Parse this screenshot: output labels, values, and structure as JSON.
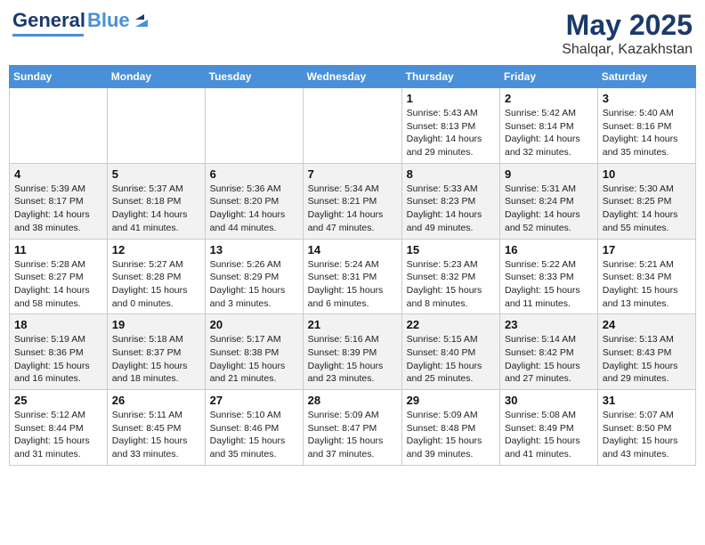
{
  "header": {
    "logo_general": "General",
    "logo_blue": "Blue",
    "month_year": "May 2025",
    "location": "Shalqar, Kazakhstan"
  },
  "days_of_week": [
    "Sunday",
    "Monday",
    "Tuesday",
    "Wednesday",
    "Thursday",
    "Friday",
    "Saturday"
  ],
  "weeks": [
    [
      {
        "day": "",
        "info": ""
      },
      {
        "day": "",
        "info": ""
      },
      {
        "day": "",
        "info": ""
      },
      {
        "day": "",
        "info": ""
      },
      {
        "day": "1",
        "info": "Sunrise: 5:43 AM\nSunset: 8:13 PM\nDaylight: 14 hours\nand 29 minutes."
      },
      {
        "day": "2",
        "info": "Sunrise: 5:42 AM\nSunset: 8:14 PM\nDaylight: 14 hours\nand 32 minutes."
      },
      {
        "day": "3",
        "info": "Sunrise: 5:40 AM\nSunset: 8:16 PM\nDaylight: 14 hours\nand 35 minutes."
      }
    ],
    [
      {
        "day": "4",
        "info": "Sunrise: 5:39 AM\nSunset: 8:17 PM\nDaylight: 14 hours\nand 38 minutes."
      },
      {
        "day": "5",
        "info": "Sunrise: 5:37 AM\nSunset: 8:18 PM\nDaylight: 14 hours\nand 41 minutes."
      },
      {
        "day": "6",
        "info": "Sunrise: 5:36 AM\nSunset: 8:20 PM\nDaylight: 14 hours\nand 44 minutes."
      },
      {
        "day": "7",
        "info": "Sunrise: 5:34 AM\nSunset: 8:21 PM\nDaylight: 14 hours\nand 47 minutes."
      },
      {
        "day": "8",
        "info": "Sunrise: 5:33 AM\nSunset: 8:23 PM\nDaylight: 14 hours\nand 49 minutes."
      },
      {
        "day": "9",
        "info": "Sunrise: 5:31 AM\nSunset: 8:24 PM\nDaylight: 14 hours\nand 52 minutes."
      },
      {
        "day": "10",
        "info": "Sunrise: 5:30 AM\nSunset: 8:25 PM\nDaylight: 14 hours\nand 55 minutes."
      }
    ],
    [
      {
        "day": "11",
        "info": "Sunrise: 5:28 AM\nSunset: 8:27 PM\nDaylight: 14 hours\nand 58 minutes."
      },
      {
        "day": "12",
        "info": "Sunrise: 5:27 AM\nSunset: 8:28 PM\nDaylight: 15 hours\nand 0 minutes."
      },
      {
        "day": "13",
        "info": "Sunrise: 5:26 AM\nSunset: 8:29 PM\nDaylight: 15 hours\nand 3 minutes."
      },
      {
        "day": "14",
        "info": "Sunrise: 5:24 AM\nSunset: 8:31 PM\nDaylight: 15 hours\nand 6 minutes."
      },
      {
        "day": "15",
        "info": "Sunrise: 5:23 AM\nSunset: 8:32 PM\nDaylight: 15 hours\nand 8 minutes."
      },
      {
        "day": "16",
        "info": "Sunrise: 5:22 AM\nSunset: 8:33 PM\nDaylight: 15 hours\nand 11 minutes."
      },
      {
        "day": "17",
        "info": "Sunrise: 5:21 AM\nSunset: 8:34 PM\nDaylight: 15 hours\nand 13 minutes."
      }
    ],
    [
      {
        "day": "18",
        "info": "Sunrise: 5:19 AM\nSunset: 8:36 PM\nDaylight: 15 hours\nand 16 minutes."
      },
      {
        "day": "19",
        "info": "Sunrise: 5:18 AM\nSunset: 8:37 PM\nDaylight: 15 hours\nand 18 minutes."
      },
      {
        "day": "20",
        "info": "Sunrise: 5:17 AM\nSunset: 8:38 PM\nDaylight: 15 hours\nand 21 minutes."
      },
      {
        "day": "21",
        "info": "Sunrise: 5:16 AM\nSunset: 8:39 PM\nDaylight: 15 hours\nand 23 minutes."
      },
      {
        "day": "22",
        "info": "Sunrise: 5:15 AM\nSunset: 8:40 PM\nDaylight: 15 hours\nand 25 minutes."
      },
      {
        "day": "23",
        "info": "Sunrise: 5:14 AM\nSunset: 8:42 PM\nDaylight: 15 hours\nand 27 minutes."
      },
      {
        "day": "24",
        "info": "Sunrise: 5:13 AM\nSunset: 8:43 PM\nDaylight: 15 hours\nand 29 minutes."
      }
    ],
    [
      {
        "day": "25",
        "info": "Sunrise: 5:12 AM\nSunset: 8:44 PM\nDaylight: 15 hours\nand 31 minutes."
      },
      {
        "day": "26",
        "info": "Sunrise: 5:11 AM\nSunset: 8:45 PM\nDaylight: 15 hours\nand 33 minutes."
      },
      {
        "day": "27",
        "info": "Sunrise: 5:10 AM\nSunset: 8:46 PM\nDaylight: 15 hours\nand 35 minutes."
      },
      {
        "day": "28",
        "info": "Sunrise: 5:09 AM\nSunset: 8:47 PM\nDaylight: 15 hours\nand 37 minutes."
      },
      {
        "day": "29",
        "info": "Sunrise: 5:09 AM\nSunset: 8:48 PM\nDaylight: 15 hours\nand 39 minutes."
      },
      {
        "day": "30",
        "info": "Sunrise: 5:08 AM\nSunset: 8:49 PM\nDaylight: 15 hours\nand 41 minutes."
      },
      {
        "day": "31",
        "info": "Sunrise: 5:07 AM\nSunset: 8:50 PM\nDaylight: 15 hours\nand 43 minutes."
      }
    ]
  ]
}
